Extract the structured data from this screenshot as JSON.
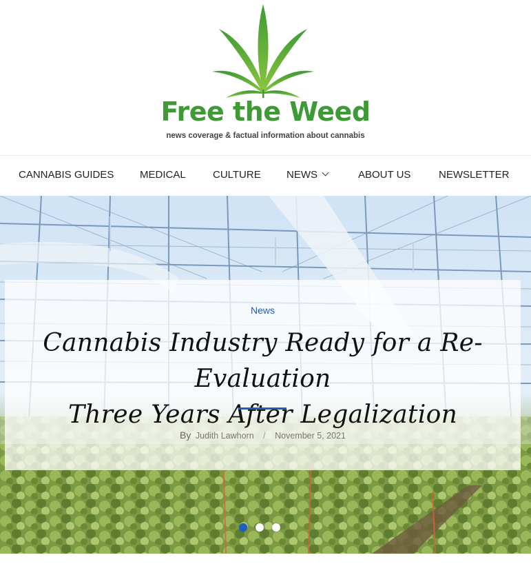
{
  "brand": {
    "title": "Free the Weed",
    "tagline": "news coverage & factual information about cannabis",
    "leaf_icon": "cannabis-leaf-icon",
    "colors": {
      "green": "#3e9a35",
      "light_green": "#7cc142",
      "accent_blue": "#1d5fbf"
    }
  },
  "nav": {
    "items": [
      {
        "label": "CANNABIS GUIDES"
      },
      {
        "label": "MEDICAL"
      },
      {
        "label": "CULTURE"
      },
      {
        "label": "NEWS",
        "icon": "chevron-down-icon"
      },
      {
        "label": "ABOUT US"
      },
      {
        "label": "NEWSLETTER"
      }
    ]
  },
  "hero": {
    "category": "News",
    "title_line1": "Cannabis Industry Ready for a Re-Evaluation",
    "title_line2": "Three Years After Legalization",
    "by_label": "By",
    "author": "Judith Lawhorn",
    "separator": "/",
    "date": "November 5, 2021",
    "slides": {
      "count": 3,
      "active_index": 0
    }
  }
}
